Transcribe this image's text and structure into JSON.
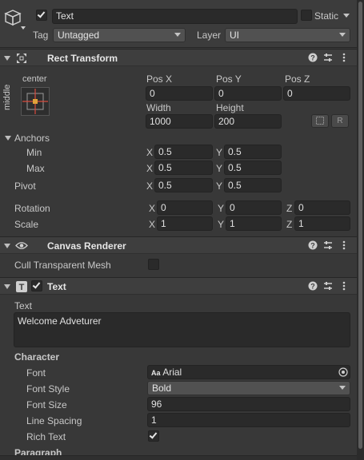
{
  "object": {
    "active": true,
    "name": "Text",
    "static_label": "Static",
    "tag_label": "Tag",
    "tag_value": "Untagged",
    "layer_label": "Layer",
    "layer_value": "UI"
  },
  "rect_transform": {
    "title": "Rect Transform",
    "anchor_h": "center",
    "anchor_v": "middle",
    "pos_x_label": "Pos X",
    "pos_y_label": "Pos Y",
    "pos_z_label": "Pos Z",
    "pos_x": "0",
    "pos_y": "0",
    "pos_z": "0",
    "width_label": "Width",
    "height_label": "Height",
    "width": "1000",
    "height": "200",
    "raw_button": "R",
    "anchors_label": "Anchors",
    "min_label": "Min",
    "max_label": "Max",
    "min_x": "0.5",
    "min_y": "0.5",
    "max_x": "0.5",
    "max_y": "0.5",
    "pivot_label": "Pivot",
    "pivot_x": "0.5",
    "pivot_y": "0.5",
    "rotation_label": "Rotation",
    "rot_x": "0",
    "rot_y": "0",
    "rot_z": "0",
    "scale_label": "Scale",
    "scale_x": "1",
    "scale_y": "1",
    "scale_z": "1",
    "axis_x": "X",
    "axis_y": "Y",
    "axis_z": "Z"
  },
  "canvas_renderer": {
    "title": "Canvas Renderer",
    "cull_label": "Cull Transparent Mesh",
    "cull_checked": false
  },
  "text_component": {
    "title": "Text",
    "enabled": true,
    "text_label": "Text",
    "text_value": "Welcome Adveturer",
    "character_label": "Character",
    "font_label": "Font",
    "font_icon": "Aa",
    "font_value": "Arial",
    "font_style_label": "Font Style",
    "font_style_value": "Bold",
    "font_size_label": "Font Size",
    "font_size_value": "96",
    "line_spacing_label": "Line Spacing",
    "line_spacing_value": "1",
    "rich_text_label": "Rich Text",
    "rich_text_checked": true,
    "paragraph_label": "Paragraph"
  }
}
